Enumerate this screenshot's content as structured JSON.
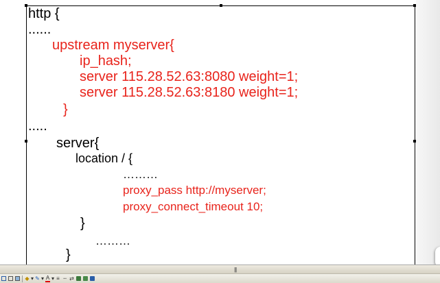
{
  "code": {
    "l1": "http {",
    "l2": "......",
    "l3": "upstream myserver{",
    "l4": "ip_hash;",
    "l5": "server 115.28.52.63:8080 weight=1;",
    "l6": "server 115.28.52.63:8180 weight=1;",
    "l7": "}",
    "l8": ".....",
    "l9": "server{",
    "l10": "location / {",
    "l11": "………",
    "l12": "proxy_pass http://myserver;",
    "l13": "proxy_connect_timeout 10;",
    "l14": "}",
    "l15": "………",
    "l16": "}"
  },
  "toolbar": {
    "splitter_grip": "|||",
    "font_color_label": "A"
  },
  "colors": {
    "text": "#000000",
    "highlight": "#e8231b"
  }
}
